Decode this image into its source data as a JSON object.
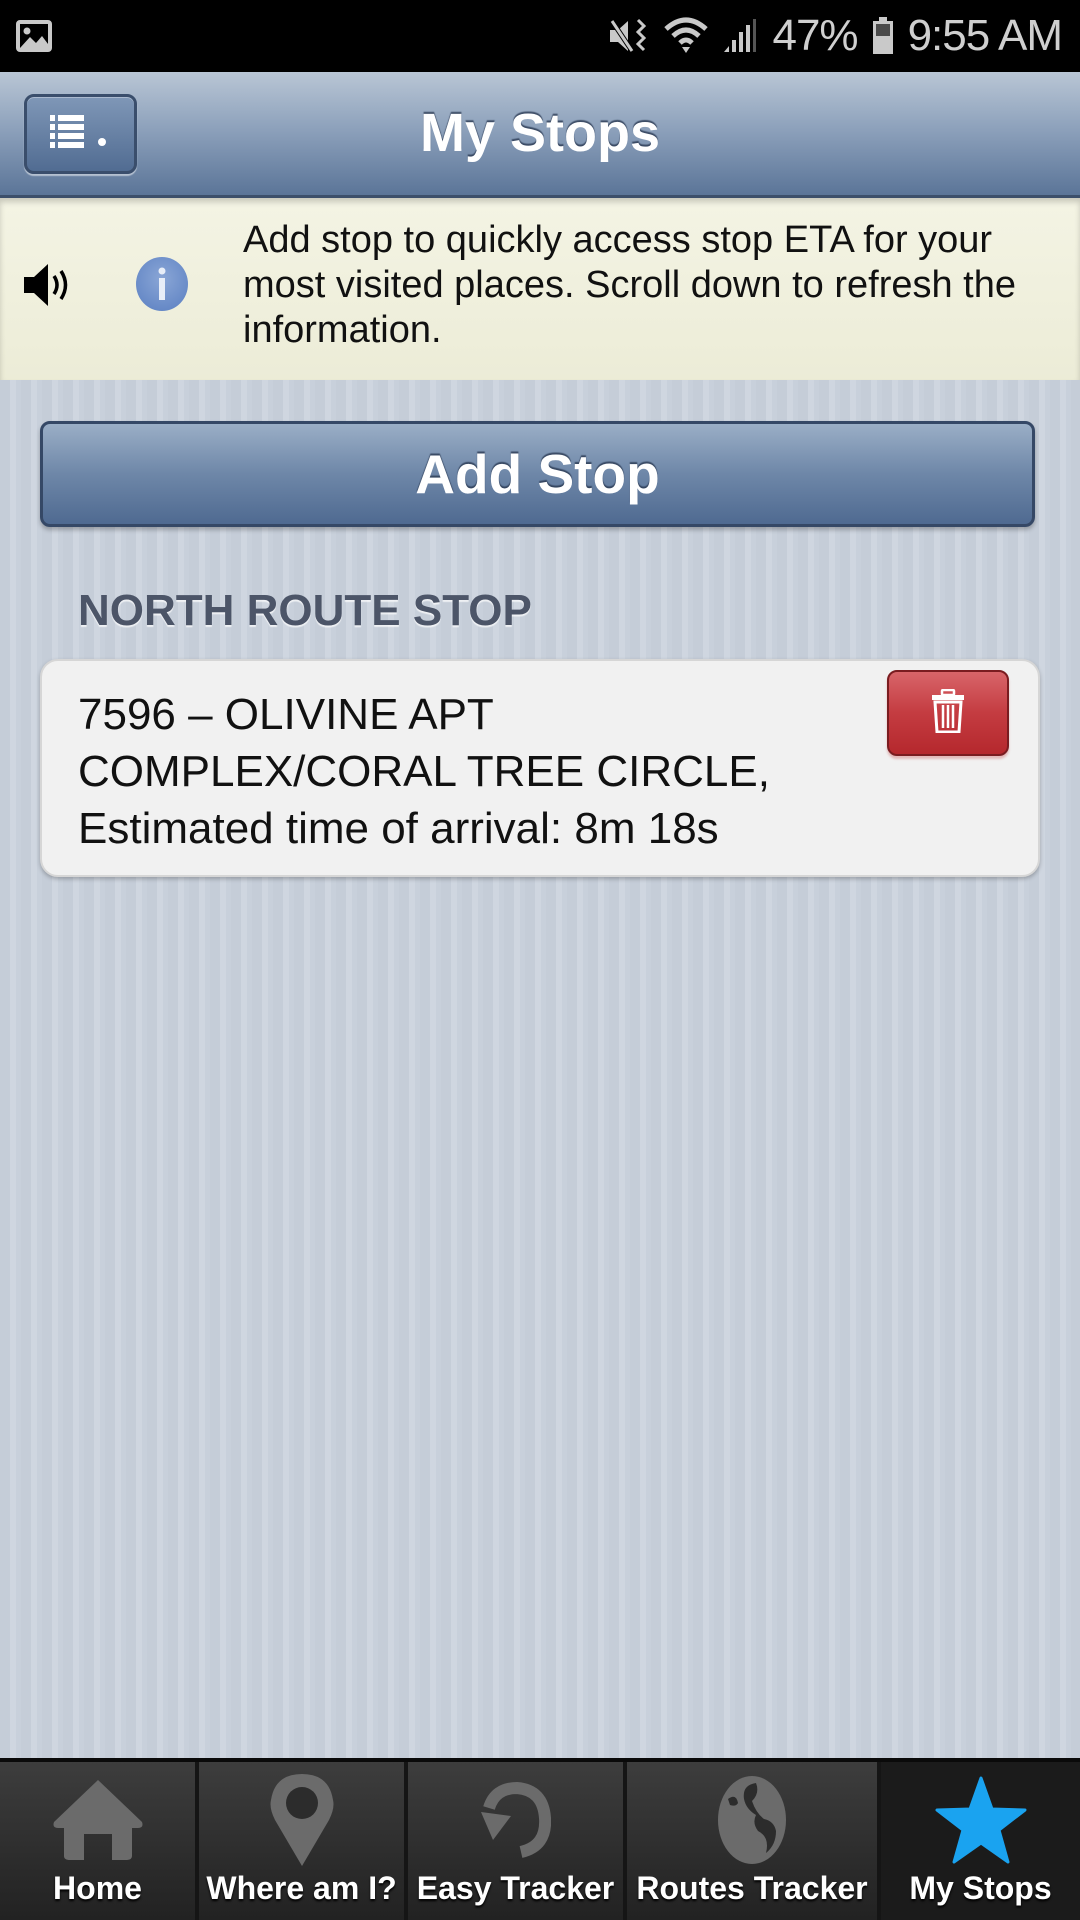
{
  "status_bar": {
    "left_icons": [
      "image-notification-icon"
    ],
    "right_icons": [
      "vibrate-mute-icon",
      "wifi-icon",
      "cell-signal-icon",
      "battery-icon"
    ],
    "battery": "47%",
    "time": "9:55 AM"
  },
  "header": {
    "menu_icon": "list-menu-icon",
    "title": "My Stops"
  },
  "info_banner": {
    "speaker_icon": "speaker-icon",
    "info_icon": "info-icon",
    "text": "Add stop to quickly access stop ETA for your most visited places. Scroll down to refresh the information."
  },
  "add_stop": {
    "label": "Add Stop"
  },
  "sections": [
    {
      "heading": "NORTH ROUTE STOP",
      "stops": [
        {
          "line1": "7596 – OLIVINE APT",
          "line2": "COMPLEX/CORAL TREE CIRCLE,",
          "line3": "Estimated time of arrival: 8m 18s",
          "delete_icon": "trash-icon"
        }
      ]
    }
  ],
  "tab_bar": {
    "active_color": "#1aa3f0",
    "inactive_color": "#6b6b6b",
    "tabs": [
      {
        "label": "Home",
        "icon": "home-icon",
        "active": false
      },
      {
        "label": "Where am I?",
        "icon": "map-pin-icon",
        "active": false
      },
      {
        "label": "Easy Tracker",
        "icon": "refresh-arrow-icon",
        "active": false
      },
      {
        "label": "Routes Tracker",
        "icon": "globe-icon",
        "active": false
      },
      {
        "label": "My Stops",
        "icon": "star-icon",
        "active": true
      }
    ]
  }
}
